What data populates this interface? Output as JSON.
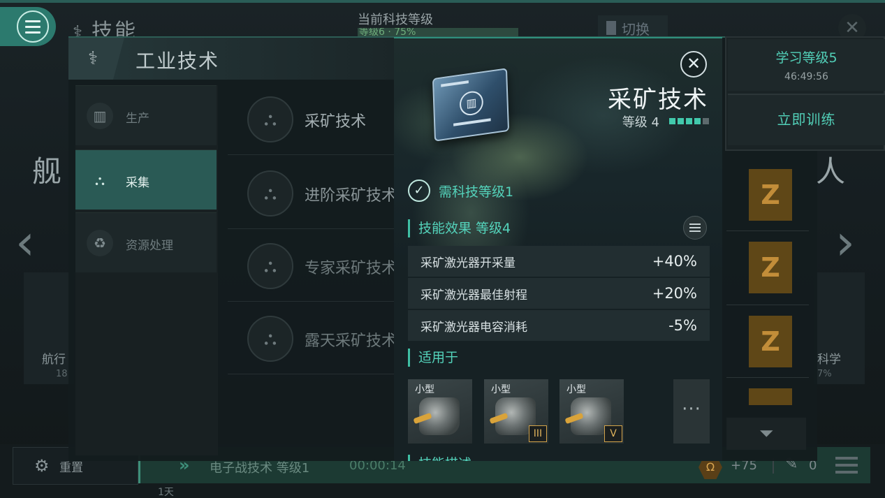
{
  "background": {
    "title": "技能",
    "tech_level_label": "当前科技等级",
    "tech_level_value": "等级6 · 75%",
    "switch_label": "切换",
    "left_section": "舰",
    "right_section": "人",
    "left_card": {
      "label": "航行",
      "value": "18"
    },
    "right_card": {
      "label": "科学",
      "value": "7%"
    }
  },
  "panel": {
    "title": "工业技术",
    "nav": [
      {
        "label": "生产",
        "icon": "factory-icon"
      },
      {
        "label": "采集",
        "icon": "mining-icon"
      },
      {
        "label": "资源处理",
        "icon": "recycle-icon"
      }
    ],
    "skills": [
      {
        "name": "采矿技术"
      },
      {
        "name": "进阶采矿技术"
      },
      {
        "name": "专家采矿技术"
      },
      {
        "name": "露天采矿技术"
      }
    ],
    "z_badge": "Z"
  },
  "training": {
    "learn_level": "学习等级5",
    "remaining": "46:49:56",
    "train_now": "立即训练"
  },
  "detail": {
    "title": "采矿技术",
    "level": "等级 4",
    "level_current": 4,
    "level_max": 5,
    "requirement": "需科技等级1",
    "effect_heading": "技能效果 等级4",
    "effects": [
      {
        "name": "采矿激光器开采量",
        "value": "+40%"
      },
      {
        "name": "采矿激光器最佳射程",
        "value": "+20%"
      },
      {
        "name": "采矿激光器电容消耗",
        "value": "-5%"
      }
    ],
    "applies_heading": "适用于",
    "ships": [
      {
        "size": "小型",
        "tier": ""
      },
      {
        "size": "小型",
        "tier": "III"
      },
      {
        "size": "小型",
        "tier": "V"
      }
    ],
    "more": "···",
    "desc_heading": "技能描述"
  },
  "bottom": {
    "reset": "重置",
    "queue": "电子战技术 等级1",
    "queue_timer": "00:00:14",
    "queue_day": "1天",
    "omega_symbol": "Ω",
    "omega_value": "+75",
    "pen_value": "0"
  },
  "colors": {
    "accent": "#54d3bb",
    "active_nav": "#2a5a55",
    "gold": "#c28d39"
  }
}
